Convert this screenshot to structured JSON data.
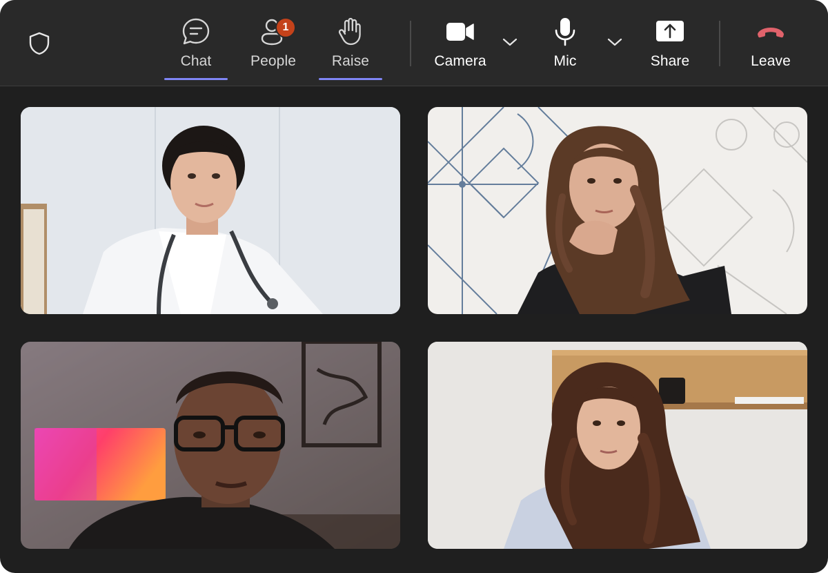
{
  "toolbar": {
    "chat_label": "Chat",
    "people_label": "People",
    "people_badge": "1",
    "raise_label": "Raise",
    "camera_label": "Camera",
    "mic_label": "Mic",
    "share_label": "Share",
    "leave_label": "Leave"
  },
  "icons": {
    "security": "shield-icon",
    "chat": "chat-icon",
    "people": "people-icon",
    "raise": "hand-icon",
    "camera": "camera-icon",
    "mic": "mic-icon",
    "share": "share-screen-icon",
    "leave": "phone-hangup-icon",
    "dropdown": "chevron-down-icon"
  },
  "colors": {
    "accent": "#7f85f5",
    "badge": "#c4421a",
    "leave": "#e0626b",
    "toolbar_bg": "#292929",
    "stage_bg": "#1f1f1f"
  },
  "participants": [
    {
      "tile": "top-left",
      "description_icon": "video-feed"
    },
    {
      "tile": "top-right",
      "description_icon": "video-feed"
    },
    {
      "tile": "bottom-left",
      "description_icon": "video-feed"
    },
    {
      "tile": "bottom-right",
      "description_icon": "video-feed"
    }
  ]
}
